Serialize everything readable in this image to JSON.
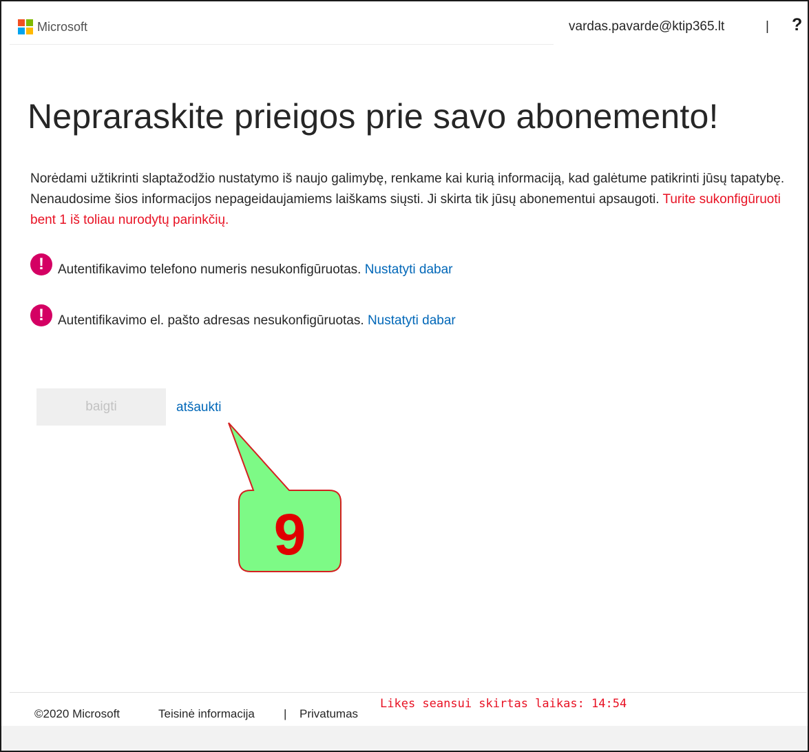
{
  "header": {
    "brand": "Microsoft",
    "user_email": "vardas.pavarde@ktip365.lt",
    "separator": "|",
    "help_icon": "?",
    "logo_colors": [
      "#f25022",
      "#7fba00",
      "#00a4ef",
      "#ffb900"
    ]
  },
  "main": {
    "title": "Nepraraskite prieigos prie savo abonemento!",
    "intro": "Norėdami užtikrinti slaptažodžio nustatymo iš naujo galimybę, renkame kai kurią informaciją, kad galėtume patikrinti jūsų tapatybę. Nenaudosime šios informacijos nepageidaujamiems laiškams siųsti. Ji skirta tik jūsų abonementui apsaugoti.",
    "intro_required": "Turite sukonfigūruoti bent 1 iš toliau nurodytų parinkčių.",
    "items": [
      {
        "icon": "alert-icon",
        "text": "Autentifikavimo telefono numeris nesukonfigūruotas.",
        "link": "Nustatyti dabar"
      },
      {
        "icon": "alert-icon",
        "text": "Autentifikavimo el. pašto adresas nesukonfigūruotas.",
        "link": "Nustatyti dabar"
      }
    ],
    "finish_label": "baigti",
    "cancel_label": "atšaukti"
  },
  "annotation": {
    "step_number": "9",
    "fill_color": "#7dfa86",
    "border_color": "#d42020"
  },
  "footer": {
    "copyright": "©2020 Microsoft",
    "legal": "Teisinė informacija",
    "separator": "|",
    "privacy": "Privatumas",
    "session_timer": "Likęs seansui skirtas laikas: 14:54"
  },
  "colors": {
    "link": "#0067b8",
    "required": "#e81123",
    "alert": "#d40063"
  }
}
